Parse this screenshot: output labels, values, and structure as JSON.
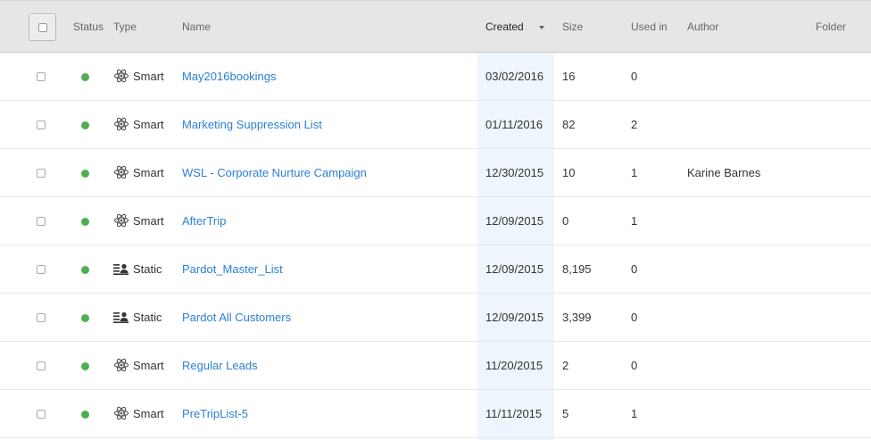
{
  "columns": {
    "status": "Status",
    "type": "Type",
    "name": "Name",
    "created": "Created",
    "size": "Size",
    "used_in": "Used in",
    "author": "Author",
    "folder": "Folder"
  },
  "rows": [
    {
      "type": "Smart",
      "type_icon": "atom-icon",
      "name": "May2016bookings",
      "created": "03/02/2016",
      "size": "16",
      "used_in": "0",
      "author": "",
      "status_color": "#4caf50"
    },
    {
      "type": "Smart",
      "type_icon": "atom-icon",
      "name": "Marketing Suppression List",
      "created": "01/11/2016",
      "size": "82",
      "used_in": "2",
      "author": "",
      "status_color": "#4caf50"
    },
    {
      "type": "Smart",
      "type_icon": "atom-icon",
      "name": "WSL - Corporate Nurture Campaign",
      "created": "12/30/2015",
      "size": "10",
      "used_in": "1",
      "author": "Karine Barnes",
      "status_color": "#4caf50"
    },
    {
      "type": "Smart",
      "type_icon": "atom-icon",
      "name": "AfterTrip",
      "created": "12/09/2015",
      "size": "0",
      "used_in": "1",
      "author": "",
      "status_color": "#4caf50"
    },
    {
      "type": "Static",
      "type_icon": "static-list-icon",
      "name": "Pardot_Master_List",
      "created": "12/09/2015",
      "size": "8,195",
      "used_in": "0",
      "author": "",
      "status_color": "#4caf50"
    },
    {
      "type": "Static",
      "type_icon": "static-list-icon",
      "name": "Pardot All Customers",
      "created": "12/09/2015",
      "size": "3,399",
      "used_in": "0",
      "author": "",
      "status_color": "#4caf50"
    },
    {
      "type": "Smart",
      "type_icon": "atom-icon",
      "name": "Regular Leads",
      "created": "11/20/2015",
      "size": "2",
      "used_in": "0",
      "author": "",
      "status_color": "#4caf50"
    },
    {
      "type": "Smart",
      "type_icon": "atom-icon",
      "name": "PreTripList-5",
      "created": "11/11/2015",
      "size": "5",
      "used_in": "1",
      "author": "",
      "status_color": "#4caf50"
    }
  ],
  "colors": {
    "link": "#2a7fd4",
    "status_active": "#4caf50",
    "sorted_column_bg": "#eef5fd"
  }
}
